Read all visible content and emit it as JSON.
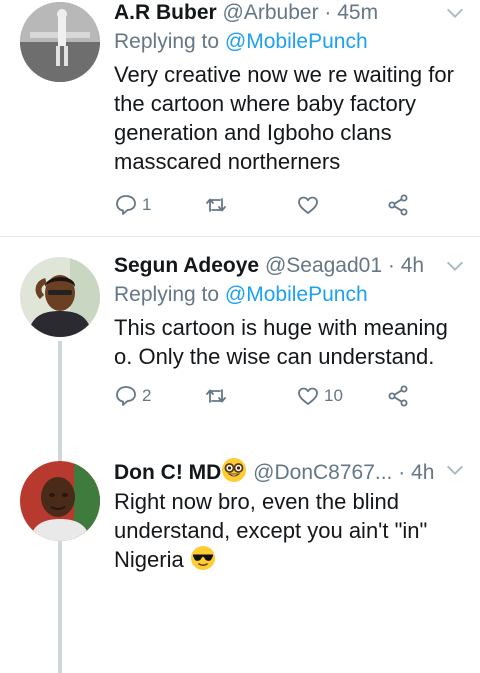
{
  "tweets": [
    {
      "name": "A.R Buber",
      "handle": "@Arbuber",
      "time": "45m",
      "replying_label": "Replying to",
      "replying_to": "@MobilePunch",
      "text": "Very creative now we re waiting for the cartoon where baby factory generation and Igboho clans masscared northerners",
      "reply_count": "1",
      "retweet_count": "",
      "like_count": ""
    },
    {
      "name": "Segun Adeoye",
      "handle": "@Seagad01",
      "time": "4h",
      "replying_label": "Replying to",
      "replying_to": "@MobilePunch",
      "text": "This cartoon is huge with meaning o. Only the wise can understand.",
      "reply_count": "2",
      "retweet_count": "",
      "like_count": "10"
    },
    {
      "name": "Don C! MD",
      "handle": "@DonC8767...",
      "time": "4h",
      "text": "Right now bro, even the blind understand, except you ain't \"in\" Nigeria"
    }
  ],
  "separator": "·",
  "icons": {
    "reply": "reply-icon",
    "retweet": "retweet-icon",
    "like": "heart-icon",
    "share": "share-icon",
    "caret": "chevron-down-icon",
    "nerd_emoji": "nerd-face-emoji",
    "sunglasses_emoji": "sunglasses-emoji"
  },
  "colors": {
    "text": "#14171a",
    "muted": "#657786",
    "link": "#1da1f2",
    "divider": "#e1e8ed",
    "thread_line": "#ccd6dd"
  }
}
